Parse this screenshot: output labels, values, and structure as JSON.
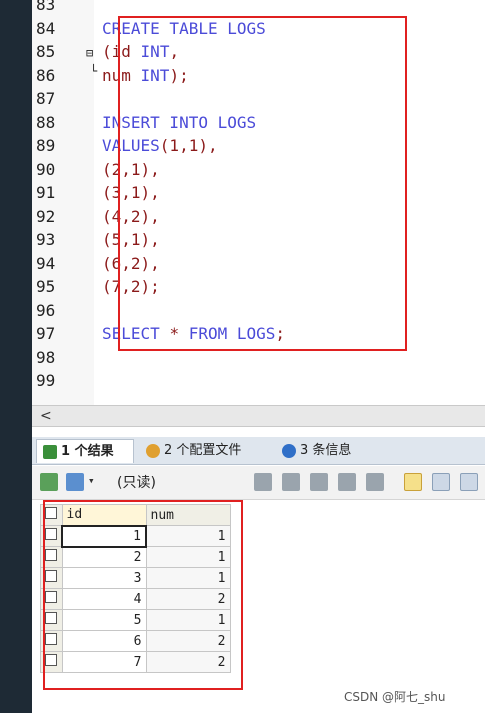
{
  "editor": {
    "lines": [
      {
        "no": "83",
        "code": []
      },
      {
        "no": "84",
        "code": [
          {
            "t": "CREATE TABLE LOGS",
            "c": "kw"
          }
        ]
      },
      {
        "no": "85",
        "code": [
          {
            "t": "(",
            "c": "tx"
          },
          {
            "t": "id ",
            "c": "tx"
          },
          {
            "t": "INT",
            "c": "kw"
          },
          {
            "t": ",",
            "c": "tx"
          }
        ]
      },
      {
        "no": "86",
        "code": [
          {
            "t": "num ",
            "c": "tx"
          },
          {
            "t": "INT",
            "c": "kw"
          },
          {
            "t": ");",
            "c": "tx"
          }
        ]
      },
      {
        "no": "87",
        "code": []
      },
      {
        "no": "88",
        "code": [
          {
            "t": "INSERT INTO LOGS",
            "c": "kw"
          }
        ]
      },
      {
        "no": "89",
        "code": [
          {
            "t": "VALUES",
            "c": "kw"
          },
          {
            "t": "(1,1),",
            "c": "tx"
          }
        ]
      },
      {
        "no": "90",
        "code": [
          {
            "t": "(2,1),",
            "c": "tx"
          }
        ]
      },
      {
        "no": "91",
        "code": [
          {
            "t": "(3,1),",
            "c": "tx"
          }
        ]
      },
      {
        "no": "92",
        "code": [
          {
            "t": "(4,2),",
            "c": "tx"
          }
        ]
      },
      {
        "no": "93",
        "code": [
          {
            "t": "(5,1),",
            "c": "tx"
          }
        ]
      },
      {
        "no": "94",
        "code": [
          {
            "t": "(6,2),",
            "c": "tx"
          }
        ]
      },
      {
        "no": "95",
        "code": [
          {
            "t": "(7,2);",
            "c": "tx"
          }
        ]
      },
      {
        "no": "96",
        "code": []
      },
      {
        "no": "97",
        "code": [
          {
            "t": "SELECT ",
            "c": "kw"
          },
          {
            "t": "* ",
            "c": "tx"
          },
          {
            "t": "FROM LOGS",
            "c": "kw"
          },
          {
            "t": ";",
            "c": "tx"
          }
        ]
      },
      {
        "no": "98",
        "code": []
      },
      {
        "no": "99",
        "code": []
      }
    ]
  },
  "scrollbar": {
    "left_arrow": "<"
  },
  "tabs": [
    {
      "label": "1 个结果",
      "icon": "result-grid-icon",
      "active": true
    },
    {
      "label": "2 个配置文件",
      "icon": "profile-icon",
      "active": false
    },
    {
      "label": "3 条信息",
      "icon": "info-icon",
      "active": false
    }
  ],
  "toolbar": {
    "mode_value": "(只读)",
    "icons": [
      "grid-export-icon",
      "grid-options-icon",
      "add-row-icon",
      "duplicate-row-icon",
      "save-icon",
      "delete-icon",
      "refresh-icon",
      "grid-view-icon",
      "form-view-icon",
      "text-view-icon"
    ]
  },
  "grid": {
    "columns": [
      "id",
      "num"
    ],
    "rows": [
      {
        "id": "1",
        "num": "1"
      },
      {
        "id": "2",
        "num": "1"
      },
      {
        "id": "3",
        "num": "1"
      },
      {
        "id": "4",
        "num": "2"
      },
      {
        "id": "5",
        "num": "1"
      },
      {
        "id": "6",
        "num": "2"
      },
      {
        "id": "7",
        "num": "2"
      }
    ]
  },
  "watermark": "CSDN @阿七_shu",
  "colors": {
    "keyword": "#4b4bd8",
    "text": "#8b1a1a",
    "highlight_box": "#e02020"
  }
}
